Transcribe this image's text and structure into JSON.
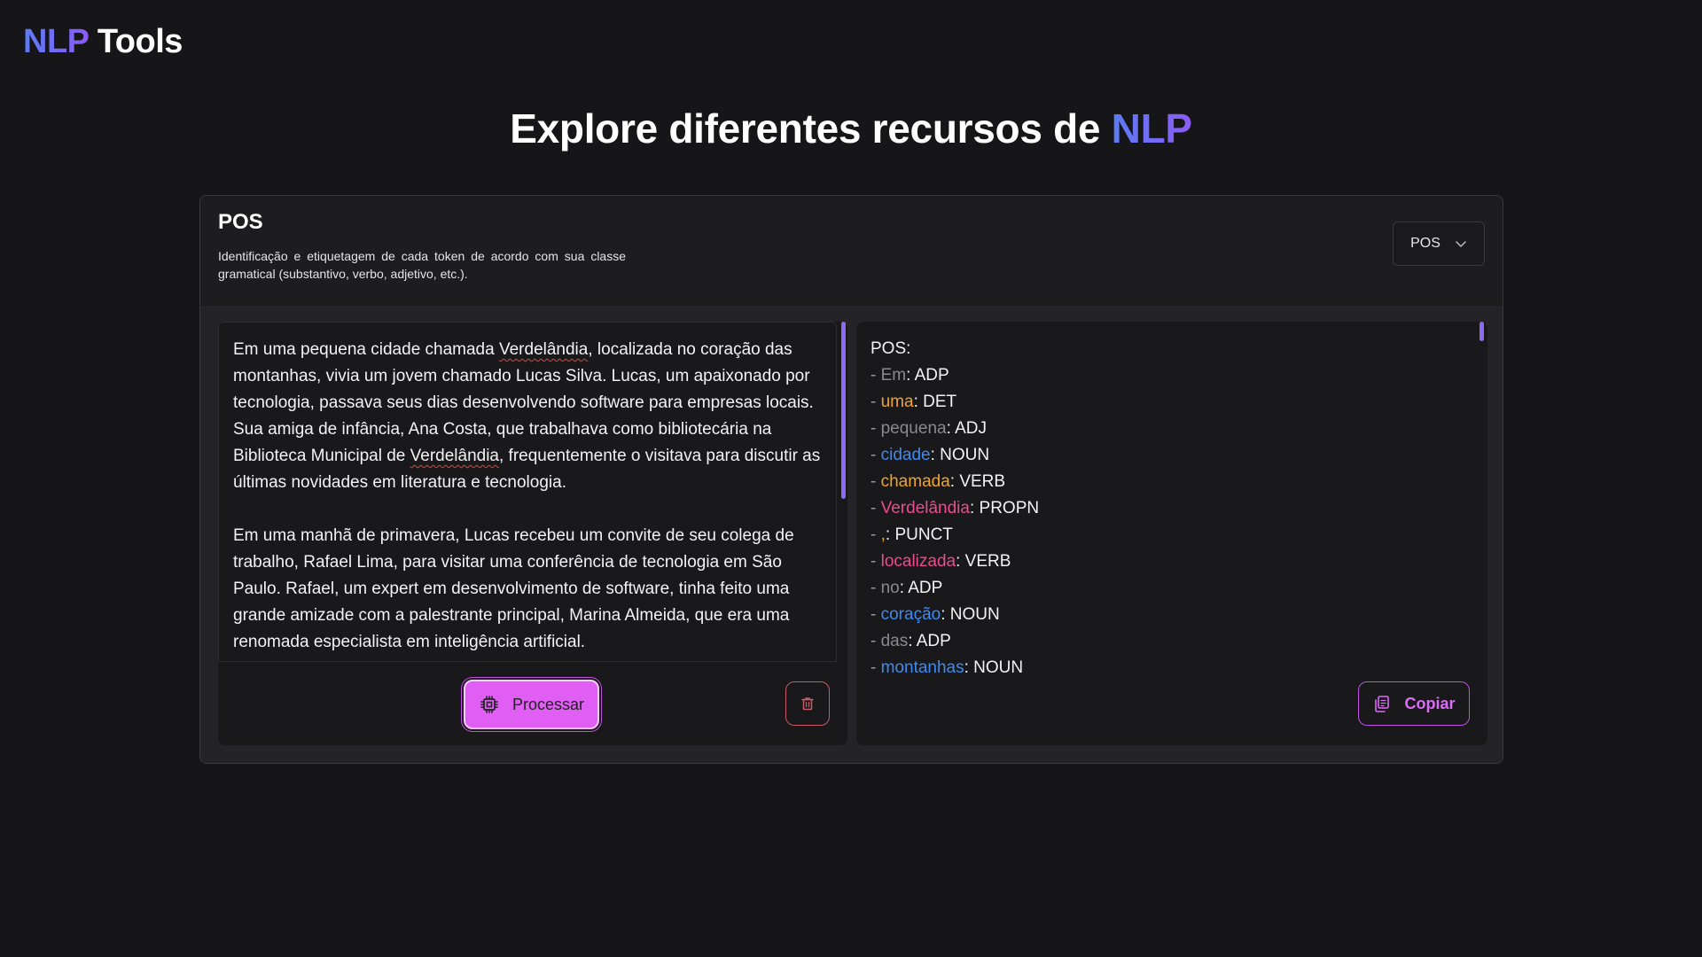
{
  "logo": {
    "accent": "NLP",
    "rest": "Tools"
  },
  "headline": {
    "prefix": "Explore diferentes recursos de ",
    "accent": "NLP"
  },
  "card": {
    "title": "POS",
    "description": "Identificação e etiquetagem de cada token de acordo com sua classe gramatical (substantivo, verbo, adjetivo, etc.).",
    "select": {
      "value": "POS",
      "icon": "chevron-down-icon"
    }
  },
  "input": {
    "paragraphs": [
      "Em uma pequena cidade chamada Verdelândia, localizada no coração das montanhas, vivia um jovem chamado Lucas Silva. Lucas, um apaixonado por tecnologia, passava seus dias desenvolvendo software para empresas locais. Sua amiga de infância, Ana Costa, que trabalhava como bibliotecária na Biblioteca Municipal de Verdelândia, frequentemente o visitava para discutir as últimas novidades em literatura e tecnologia.",
      "Em uma manhã de primavera, Lucas recebeu um convite de seu colega de trabalho, Rafael Lima, para visitar uma conferência de tecnologia em São Paulo. Rafael, um expert em desenvolvimento de software, tinha feito uma grande amizade com a palestrante principal, Marina Almeida, que era uma renomada especialista em inteligência artificial."
    ]
  },
  "actions": {
    "process_label": "Processar",
    "process_icon": "cpu-chip-icon",
    "delete_icon": "trash-icon",
    "copy_label": "Copiar",
    "copy_icon": "copy-icon"
  },
  "output": {
    "header": "POS:",
    "tokens": [
      {
        "word": "Em",
        "tag": "ADP",
        "color": "#8a8a8a"
      },
      {
        "word": "uma",
        "tag": "DET",
        "color": "#f0a52a"
      },
      {
        "word": "pequena",
        "tag": "ADJ",
        "color": "#8a8a8a"
      },
      {
        "word": "cidade",
        "tag": "NOUN",
        "color": "#3d8bf2"
      },
      {
        "word": "chamada",
        "tag": "VERB",
        "color": "#f0a52a"
      },
      {
        "word": "Verdelândia",
        "tag": "PROPN",
        "color": "#ee4a8f"
      },
      {
        "word": ",",
        "tag": "PUNCT",
        "color": "#f0a52a"
      },
      {
        "word": "localizada",
        "tag": "VERB",
        "color": "#ee4a8f"
      },
      {
        "word": "no",
        "tag": "ADP",
        "color": "#8a8a8a"
      },
      {
        "word": "coração",
        "tag": "NOUN",
        "color": "#3d8bf2"
      },
      {
        "word": "das",
        "tag": "ADP",
        "color": "#8a8a8a"
      },
      {
        "word": "montanhas",
        "tag": "NOUN",
        "color": "#3d8bf2"
      }
    ]
  },
  "colors": {
    "background": "#161517",
    "accent_gradient_start": "#5b7cf5",
    "accent_gradient_end": "#8a5cf2",
    "process_button": "#e15ef5",
    "danger": "#c95a69"
  }
}
